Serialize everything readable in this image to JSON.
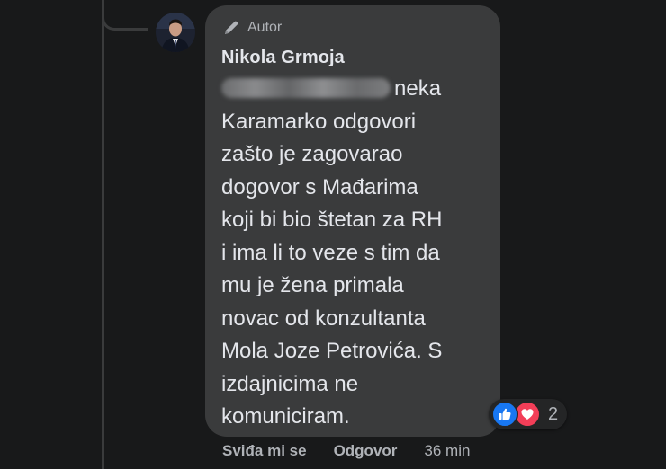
{
  "comment": {
    "author_badge": "Autor",
    "author_name": "Nikola Grmoja",
    "mention_hidden": true,
    "text": "neka\nKaramarko odgovori\nzašto je zagovarao\ndogovor s Mađarima\nkoji bi bio štetan za RH\ni ima li to veze s tim da\nmu je žena primala\nnovac od konzultanta\nMola Joze Petrovića. S\nizdajnicima ne\nkomuniciram."
  },
  "reactions": {
    "icons": [
      "like-icon",
      "love-icon"
    ],
    "count": "2",
    "like_color": "#1877f2",
    "love_color": "#f33e58"
  },
  "actions": {
    "like_label": "Sviđa mi se",
    "reply_label": "Odgovor",
    "time": "36 min"
  },
  "colors": {
    "background": "#18191a",
    "bubble": "#3a3b3c",
    "text": "#e4e6eb",
    "secondary_text": "#b0b3b8"
  }
}
